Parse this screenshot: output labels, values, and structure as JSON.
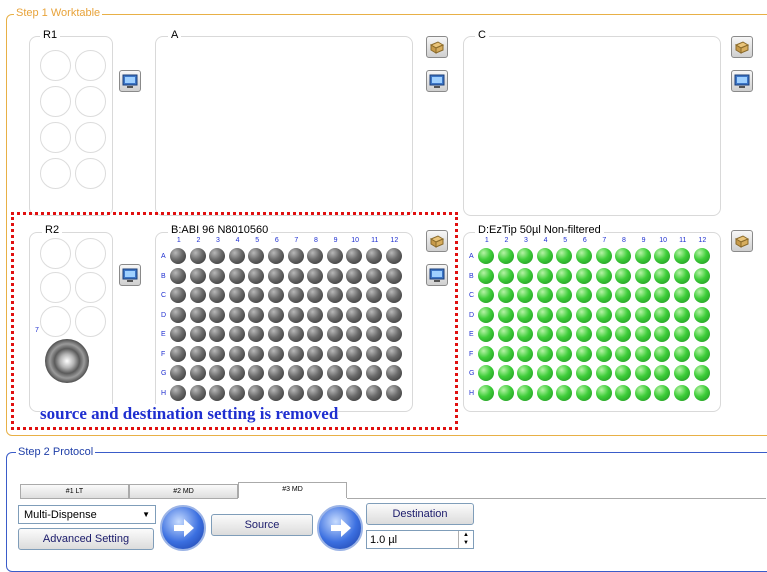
{
  "step1": {
    "title": "Step 1 Worktable"
  },
  "step2": {
    "title": "Step 2 Protocol"
  },
  "panels": {
    "r1": "R1",
    "r2": "R2",
    "a": "A",
    "c": "C",
    "b": "B:ABI 96 N8010560",
    "d": "D:EzTip 50µl Non-filtered"
  },
  "r2_position_label": "7",
  "plate_columns": [
    "1",
    "2",
    "3",
    "4",
    "5",
    "6",
    "7",
    "8",
    "9",
    "10",
    "11",
    "12"
  ],
  "plate_rows": [
    "A",
    "B",
    "C",
    "D",
    "E",
    "F",
    "G",
    "H"
  ],
  "annotation": "source and destination setting is removed",
  "tabs": [
    "#1 LT",
    "#2 MD",
    "#3 MD"
  ],
  "active_tab": "#3 MD",
  "protocol": {
    "mode_select": "Multi-Dispense",
    "advanced_setting": "Advanced Setting",
    "source": "Source",
    "destination": "Destination",
    "volume": "1.0 µl"
  },
  "icons": {
    "tip_box": "tip-box-icon",
    "monitor": "monitor-icon",
    "arrow": "right-arrow-icon"
  },
  "colors": {
    "step1_border": "#e8b046",
    "step2_border": "#3a5cc9",
    "annotation_text": "#1f2fd0",
    "dotted_border": "#e01010",
    "tip_well": "#3fce3a",
    "plate_well": "#4a4a4a"
  }
}
